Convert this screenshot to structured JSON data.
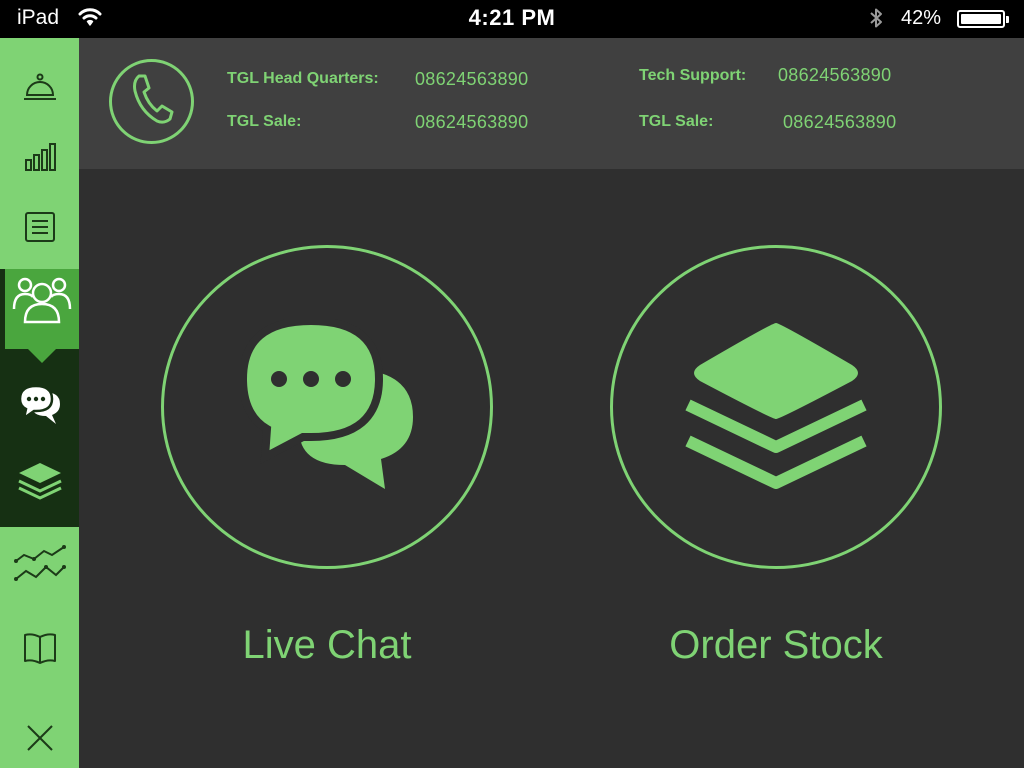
{
  "status_bar": {
    "device": "iPad",
    "time": "4:21 PM",
    "battery": "42%",
    "battery_level": 0.42
  },
  "sidebar": {
    "items": [
      {
        "id": "concierge",
        "icon": "service-bell-icon"
      },
      {
        "id": "stats",
        "icon": "bar-chart-icon"
      },
      {
        "id": "list",
        "icon": "document-list-icon"
      },
      {
        "id": "contacts",
        "icon": "people-group-icon",
        "active": true
      },
      {
        "id": "chat",
        "icon": "chat-bubbles-icon"
      },
      {
        "id": "stock",
        "icon": "layers-icon"
      },
      {
        "id": "trends",
        "icon": "line-chart-icon"
      },
      {
        "id": "catalog",
        "icon": "open-book-icon"
      },
      {
        "id": "close",
        "icon": "close-icon"
      }
    ]
  },
  "contacts": {
    "head_quarters": {
      "label": "TGL Head Quarters:",
      "number": "08624563890"
    },
    "sale_1": {
      "label": "TGL Sale:",
      "number": "08624563890"
    },
    "tech_support": {
      "label": "Tech Support:",
      "number": "08624563890"
    },
    "sale_2": {
      "label": "TGL Sale:",
      "number": "08624563890"
    }
  },
  "actions": {
    "live_chat": {
      "label": "Live Chat",
      "icon": "chat-bubbles-icon"
    },
    "order_stock": {
      "label": "Order Stock",
      "icon": "layers-icon"
    }
  },
  "colors": {
    "accent": "#7fd374",
    "accent_dark": "#4aa63e",
    "sidebar_active_bg": "#163013",
    "header_bg": "#404040",
    "main_bg": "#2f2f2f"
  }
}
